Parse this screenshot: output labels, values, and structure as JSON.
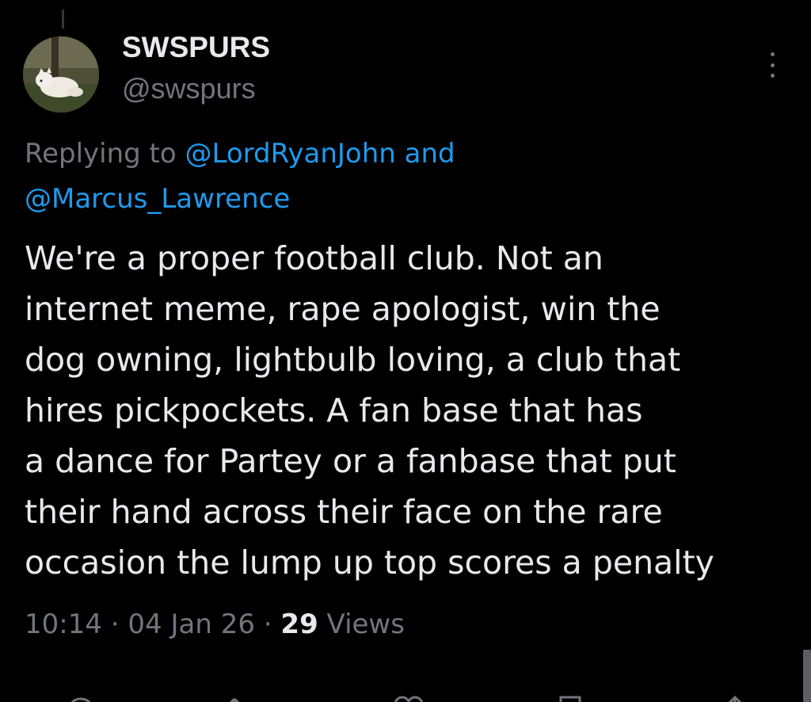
{
  "author": {
    "display_name": "SWSPURS",
    "handle": "@swspurs"
  },
  "reply_context": {
    "prefix": "Replying to ",
    "mention_1": "@LordRyanJohn",
    "joiner": " and",
    "mention_2": "@Marcus_Lawrence"
  },
  "tweet": {
    "text": "We're a proper football club. Not an\ninternet meme, rape apologist, win the\ndog owning, lightbulb loving, a club that\nhires pickpockets. A fan base that has\na dance for Partey or a fanbase that put\ntheir hand across their face on the rare\noccasion the lump up top scores a penalty"
  },
  "meta": {
    "time": "10:14",
    "separator_1": " · ",
    "date": "04 Jan 26",
    "separator_2": " · ",
    "views_count": "29",
    "views_label": " Views"
  },
  "icons": {
    "more": "more-vertical-icon",
    "reply": "reply-icon",
    "retweet": "retweet-icon",
    "like": "heart-icon",
    "bookmark": "bookmark-icon",
    "share": "share-icon"
  },
  "colors": {
    "background": "#000000",
    "text": "#e7e9ea",
    "secondary": "#71767b",
    "link": "#1d9bf0"
  }
}
